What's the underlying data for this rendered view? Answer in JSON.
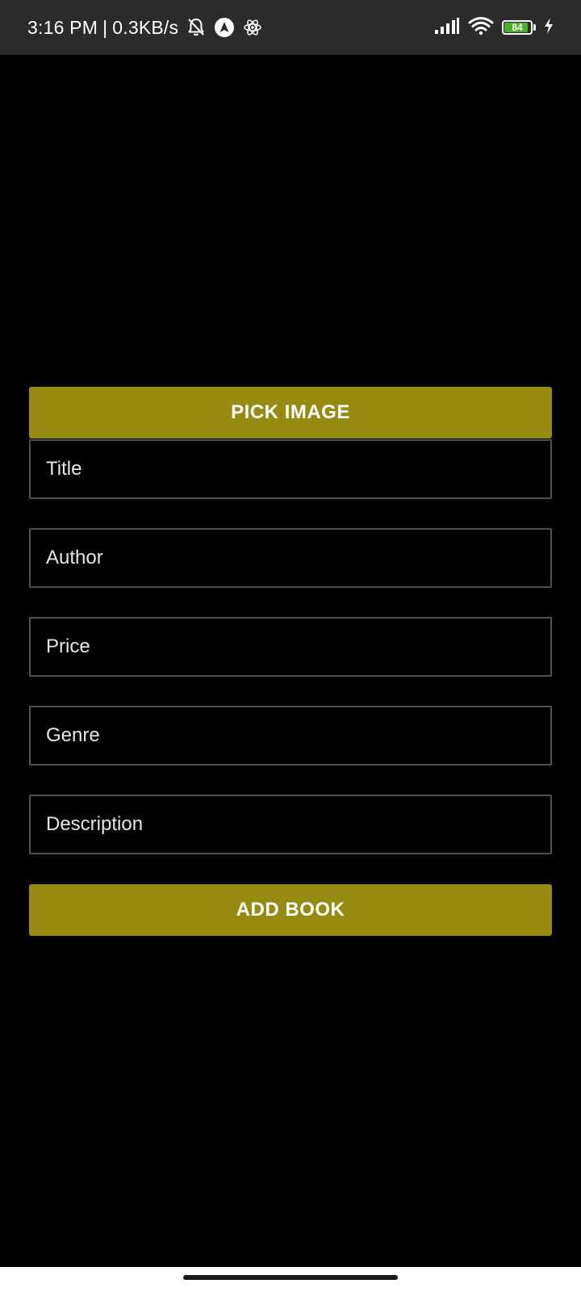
{
  "status_bar": {
    "time": "3:16 PM",
    "separator": "|",
    "network_speed": "0.3KB/s",
    "icons": [
      "bell-off-icon",
      "nav-arrow-icon",
      "atom-icon",
      "signal-icon",
      "wifi-icon",
      "battery-icon",
      "charging-icon"
    ],
    "battery_level": "84",
    "battery_fill_fraction": 0.84,
    "battery_color": "#4caf2a"
  },
  "form": {
    "pick_image_label": "PICK IMAGE",
    "fields": {
      "title_placeholder": "Title",
      "author_placeholder": "Author",
      "price_placeholder": "Price",
      "genre_placeholder": "Genre",
      "description_placeholder": "Description"
    },
    "add_book_label": "ADD BOOK"
  },
  "colors": {
    "background": "#000000",
    "accent": "#978a10",
    "field_border": "#4f4f4f",
    "status_bar": "#2b2b2b"
  }
}
